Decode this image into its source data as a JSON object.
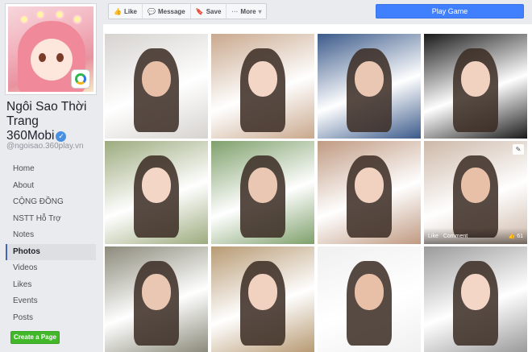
{
  "page": {
    "name": "Ngôi Sao Thời Trang 360Mobi",
    "name_lines": [
      "Ngôi Sao Thời",
      "Trang",
      "360Mobi"
    ],
    "username": "@ngoisao.360play.vn",
    "verified_glyph": "✓"
  },
  "nav": [
    {
      "label": "Home",
      "active": false
    },
    {
      "label": "About",
      "active": false
    },
    {
      "label": "CỘNG ĐỒNG",
      "active": false
    },
    {
      "label": "NSTT Hỗ Trợ",
      "active": false
    },
    {
      "label": "Notes",
      "active": false
    },
    {
      "label": "Photos",
      "active": true
    },
    {
      "label": "Videos",
      "active": false
    },
    {
      "label": "Likes",
      "active": false
    },
    {
      "label": "Events",
      "active": false
    },
    {
      "label": "Posts",
      "active": false
    }
  ],
  "create_page_label": "Create a Page",
  "actions": [
    {
      "label": "Like",
      "icon": "thumb-up-icon",
      "glyph": "👍"
    },
    {
      "label": "Message",
      "icon": "message-icon",
      "glyph": "💬"
    },
    {
      "label": "Save",
      "icon": "bookmark-icon",
      "glyph": "🔖"
    },
    {
      "label": "More",
      "icon": "more-icon",
      "glyph": "···"
    }
  ],
  "more_caret": "▾",
  "play_game_label": "Play Game",
  "hover_photo": {
    "like_label": "Like",
    "comment_label": "Comment",
    "like_count": "61",
    "edit_glyph": "✎"
  },
  "colors": {
    "accent_blue": "#4080ff",
    "nav_active_bar": "#4267b2",
    "create_green": "#42b72a"
  }
}
